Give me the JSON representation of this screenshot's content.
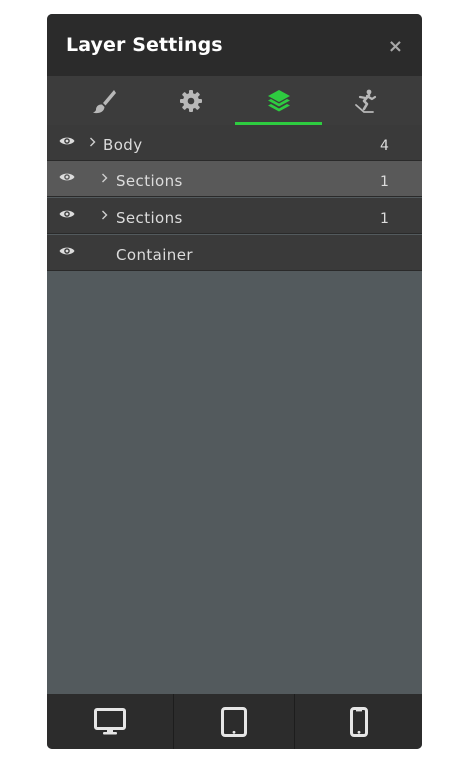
{
  "panel": {
    "title": "Layer Settings",
    "close_label": "×"
  },
  "tabs": [
    {
      "icon": "brush-icon",
      "active": false
    },
    {
      "icon": "gear-icon",
      "active": false
    },
    {
      "icon": "layers-icon",
      "active": true
    },
    {
      "icon": "skater-icon",
      "active": false
    }
  ],
  "layers": [
    {
      "label": "Body",
      "count": "4",
      "has_children": true,
      "level": 0
    },
    {
      "label": "Sections",
      "count": "1",
      "has_children": true,
      "level": 1
    },
    {
      "label": "Sections",
      "count": "1",
      "has_children": true,
      "level": 1
    },
    {
      "label": "Container",
      "count": "",
      "has_children": false,
      "level": 1
    }
  ],
  "devices": [
    {
      "icon": "desktop-icon"
    },
    {
      "icon": "tablet-icon"
    },
    {
      "icon": "mobile-icon"
    }
  ],
  "colors": {
    "accent": "#2ecc40",
    "header_bg": "#2b2b2b",
    "panel_bg": "#535a5d",
    "row_bg": "#3a3a3a",
    "row_selected_bg": "#595959"
  }
}
